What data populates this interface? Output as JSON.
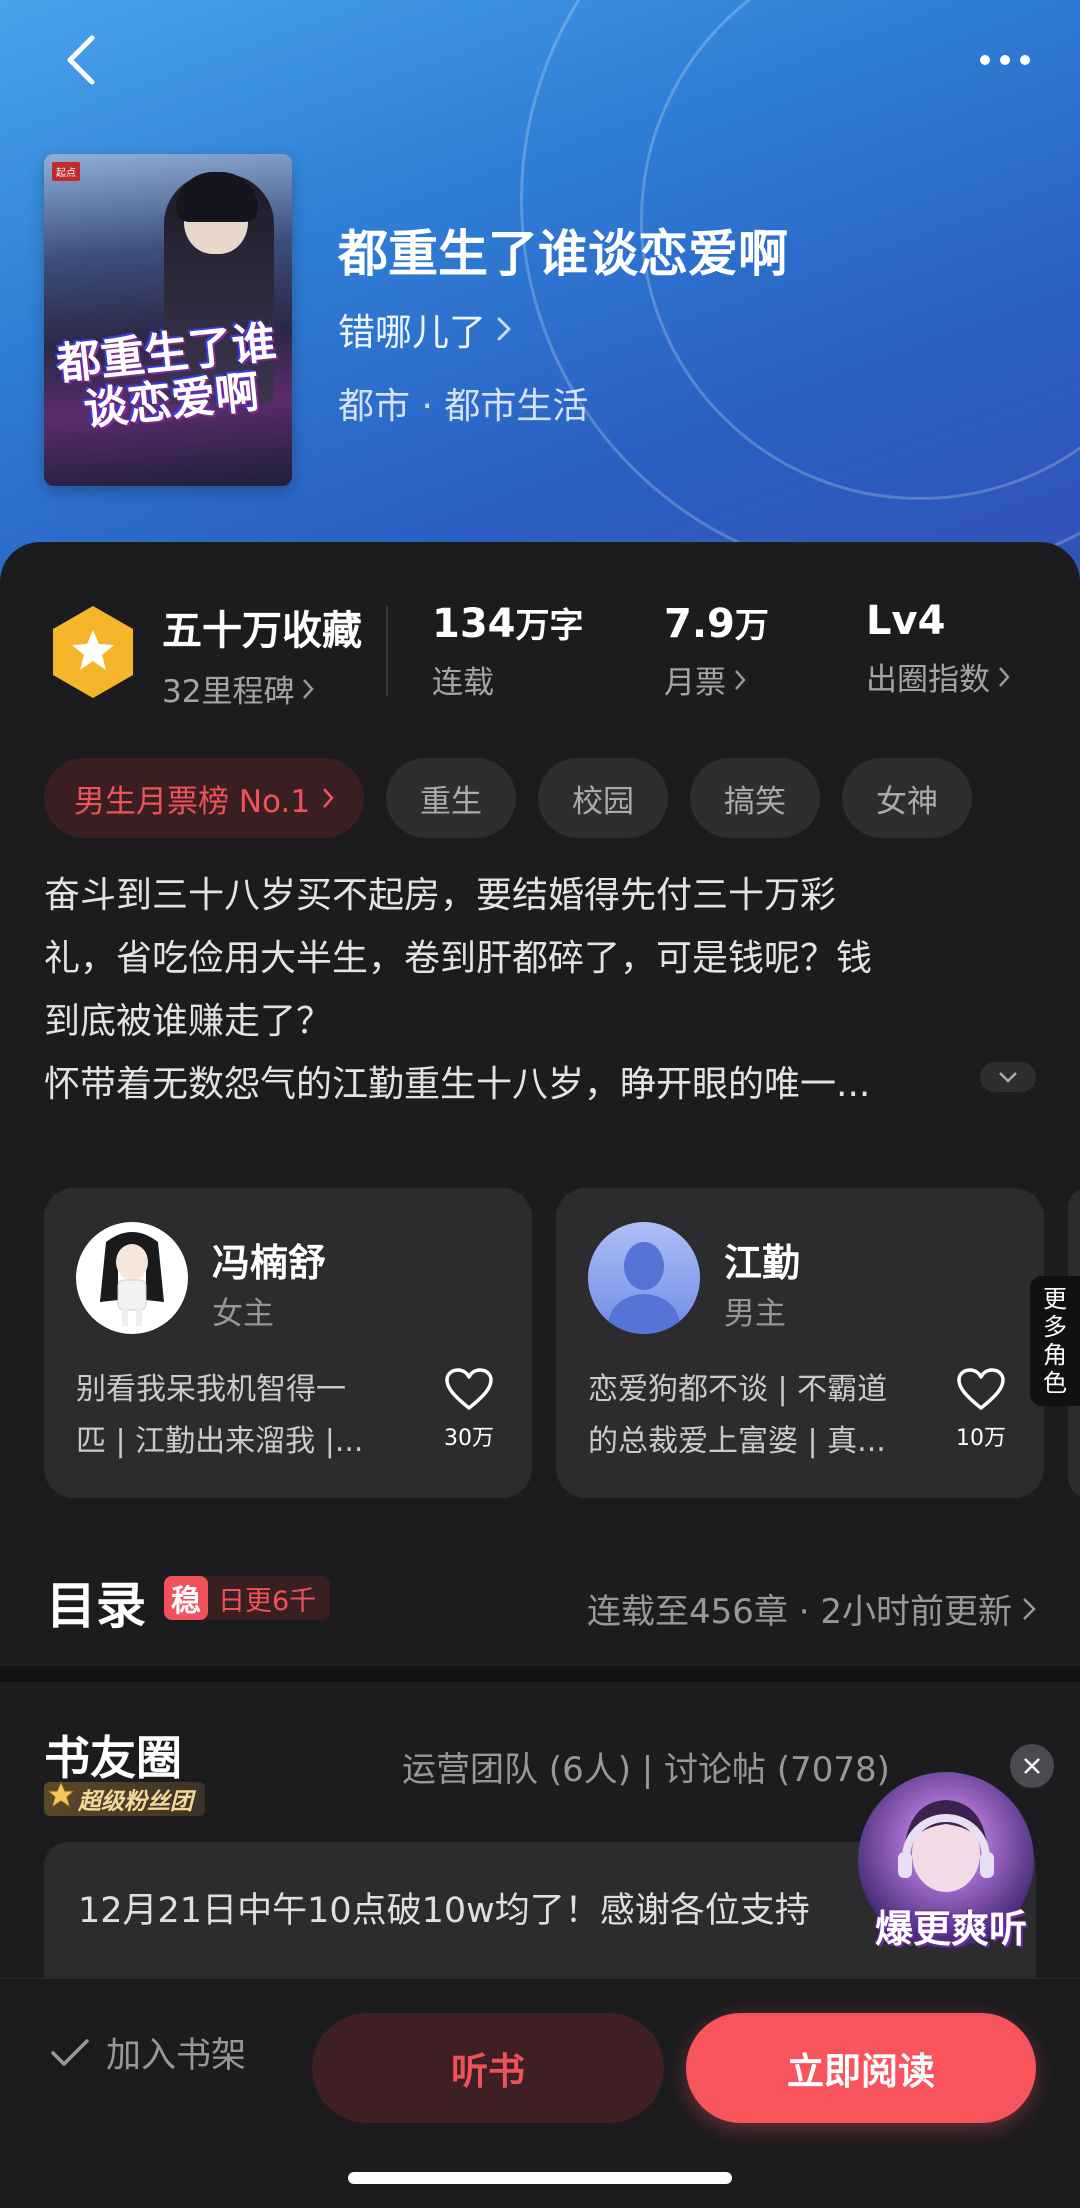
{
  "header": {
    "back_icon": "chevron-left-icon",
    "more_icon": "more-dots-icon",
    "cover_text": "都重生了谁谈恋爱啊",
    "title": "都重生了谁谈恋爱啊",
    "author": "错哪儿了",
    "genre": "都市 · 都市生活"
  },
  "stats": {
    "collect_value": "五十万收藏",
    "collect_label": "32里程碑",
    "words_value": "134",
    "words_unit": "万字",
    "words_label": "连载",
    "tickets_value": "7.9",
    "tickets_unit": "万",
    "tickets_label": "月票",
    "level_value": "Lv4",
    "level_label": "出圈指数"
  },
  "tags": {
    "rank": "男生月票榜 No.1",
    "items": [
      "重生",
      "校园",
      "搞笑",
      "女神"
    ]
  },
  "description": {
    "lines": [
      "奋斗到三十八岁买不起房，要结婚得先付三十万彩",
      "礼，省吃俭用大半生，卷到肝都碎了，可是钱呢？钱",
      "到底被谁赚走了？",
      "怀带着无数怨气的江勤重生十八岁，睁开眼的唯一..."
    ]
  },
  "roles": [
    {
      "name": "冯楠舒",
      "role": "女主",
      "intro_lines": [
        "别看我呆我机智得一",
        "匹 | 江勤出来溜我 |..."
      ],
      "likes": "30万"
    },
    {
      "name": "江勤",
      "role": "男主",
      "intro_lines": [
        "恋爱狗都不谈 | 不霸道",
        "的总裁爱上富婆 | 真..."
      ],
      "likes": "10万"
    }
  ],
  "more_roles": [
    "更",
    "多",
    "角",
    "色"
  ],
  "catalog": {
    "title": "目录",
    "stable_mark": "稳",
    "stable_text": "日更6千",
    "update": "连载至456章 · 2小时前更新"
  },
  "circle": {
    "title": "书友圈",
    "fan_badge": "超级粉丝团",
    "meta": "运营团队 (6人) | 讨论帖 (7078)",
    "post_text": "12月21日中午10点破10w均了！感谢各位支持"
  },
  "float_ad": {
    "text": "爆更爽听"
  },
  "bottom": {
    "shelf": "加入书架",
    "listen": "听书",
    "read": "立即阅读"
  },
  "colors": {
    "accent": "#f7545d",
    "badge_yellow": "#f5b52a",
    "bg": "#1c1c1e",
    "card": "#2c2c2e"
  }
}
